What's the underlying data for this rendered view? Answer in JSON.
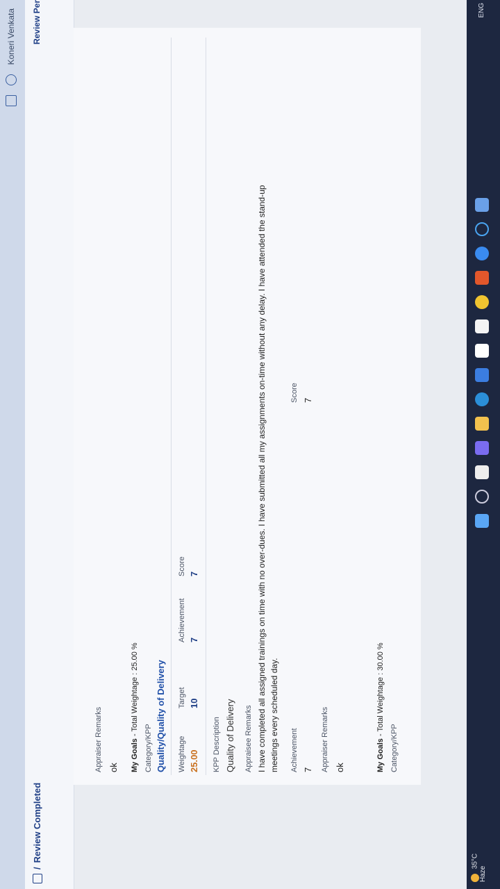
{
  "header": {
    "user_name": "Koneri Venkata",
    "breadcrumb": "Review Completed",
    "review_period_label": "Review Per"
  },
  "top_section": {
    "appraiser_remarks_label": "Appraiser Remarks",
    "appraiser_remarks_value": "ok"
  },
  "goal1": {
    "title_prefix": "My Goals",
    "title_suffix": "- Total Weightage : 25.00 %",
    "category_label": "Category/KPP",
    "category_value": "Quality/Quality of Delivery",
    "weightage_label": "Weightage",
    "weightage_value": "25.00",
    "target_label": "Target",
    "target_value": "10",
    "achievement_label": "Achievement",
    "achievement_value": "7",
    "score_label": "Score",
    "score_value": "7",
    "kpp_description_label": "KPP Description",
    "kpp_description_value": "Quality of Delivery",
    "appraisee_remarks_label": "Appraisee Remarks",
    "appraisee_remarks_line1": "I have completed all assigned trainings on time with no over-dues. I have submitted all my assignments on-time without any delay. I have attended the stand-up",
    "appraisee_remarks_line2": "meetings every scheduled day.",
    "achievement2_label": "Achievement",
    "achievement2_value": "7",
    "score2_label": "Score",
    "score2_value": "7",
    "appraiser_remarks_label": "Appraiser Remarks",
    "appraiser_remarks_value": "ok"
  },
  "goal2": {
    "title_prefix": "My Goals",
    "title_suffix": "- Total Weightage : 30.00 %",
    "category_label": "Category/KPP"
  },
  "taskbar": {
    "temperature": "35°C",
    "weather": "Haze",
    "lang": "ENG"
  },
  "colors": {
    "accent": "#1f4fa8",
    "weightage": "#c9701e"
  }
}
